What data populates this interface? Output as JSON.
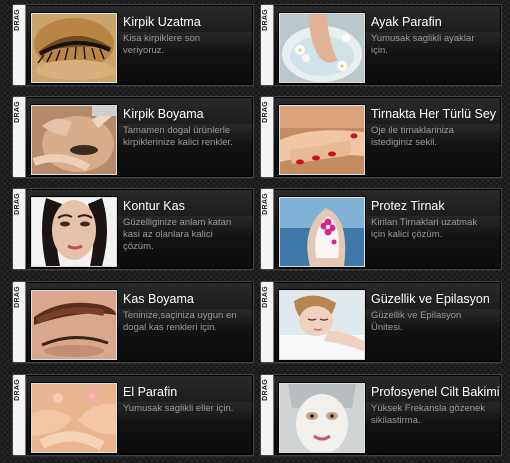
{
  "drag_label": "DRAG",
  "services": [
    {
      "title": "Kirpik Uzatma",
      "desc": "Kisa kirpiklere son veriyoruz.",
      "image": "eyelash-extension-photo"
    },
    {
      "title": "Ayak Parafin",
      "desc": "Yumusak saglikli ayaklar için.",
      "image": "foot-spa-photo"
    },
    {
      "title": "Kirpik Boyama",
      "desc": "Tamamen dogal ürünlerle kirpiklerinize kalici renkler.",
      "image": "eyelash-tint-photo"
    },
    {
      "title": "Tirnakta Her Türlü Sey",
      "desc": "Oje ile tirnaklariniza istediginiz sekil.",
      "image": "manicure-photo"
    },
    {
      "title": "Kontur Kas",
      "desc": "Güzelliginize anlam katan kasi az olanlara kalici çözüm.",
      "image": "brow-contour-portrait-photo"
    },
    {
      "title": "Protez Tirnak",
      "desc": "Kirilan Tirnaklari uzatmak için kalici çözüm.",
      "image": "nail-art-photo"
    },
    {
      "title": "Kas Boyama",
      "desc": "Teninize,saçiniza uygun en dogal kas renkleri için.",
      "image": "brow-tint-photo"
    },
    {
      "title": "Güzellik ve Epilasyon",
      "desc": "Güzellik ve Epilasyon Ünitesi.",
      "image": "relaxing-woman-photo"
    },
    {
      "title": "El Parafin",
      "desc": "Yumusak saglikli eller için.",
      "image": "hand-spa-photo"
    },
    {
      "title": "Profosyenel Cilt Bakimi",
      "desc": "Yüksek Frekansla gözenek sikilastirma.",
      "image": "face-mask-photo"
    }
  ]
}
